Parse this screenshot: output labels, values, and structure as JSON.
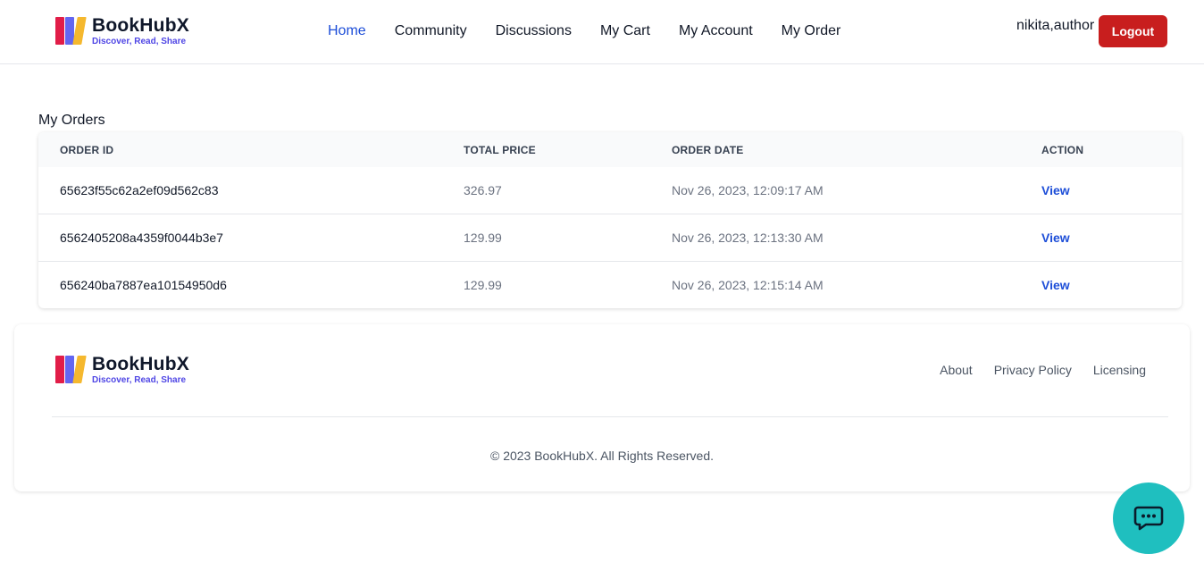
{
  "brand": {
    "name": "BookHubX",
    "tagline": "Discover, Read, Share"
  },
  "nav": [
    {
      "label": "Home"
    },
    {
      "label": "Community"
    },
    {
      "label": "Discussions"
    },
    {
      "label": "My Cart"
    },
    {
      "label": "My Account"
    },
    {
      "label": "My Order"
    }
  ],
  "user": {
    "name": "nikita,author",
    "logout_label": "Logout"
  },
  "orders": {
    "title": "My Orders",
    "columns": [
      "ORDER ID",
      "TOTAL PRICE",
      "ORDER DATE",
      "ACTION"
    ],
    "rows": [
      {
        "id": "65623f55c62a2ef09d562c83",
        "total": "326.97",
        "date": "Nov 26, 2023, 12:09:17 AM",
        "action": "View"
      },
      {
        "id": "6562405208a4359f0044b3e7",
        "total": "129.99",
        "date": "Nov 26, 2023, 12:13:30 AM",
        "action": "View"
      },
      {
        "id": "656240ba7887ea10154950d6",
        "total": "129.99",
        "date": "Nov 26, 2023, 12:15:14 AM",
        "action": "View"
      }
    ]
  },
  "footer": {
    "links": [
      "About",
      "Privacy Policy",
      "Licensing"
    ],
    "copyright": "© 2023 BookHubX. All Rights Reserved."
  },
  "icons": {
    "chat": "chat-bubble-icon"
  },
  "colors": {
    "accent": "#1d4ed8",
    "logout": "#c81e1e",
    "chat": "#1fbfbf"
  }
}
